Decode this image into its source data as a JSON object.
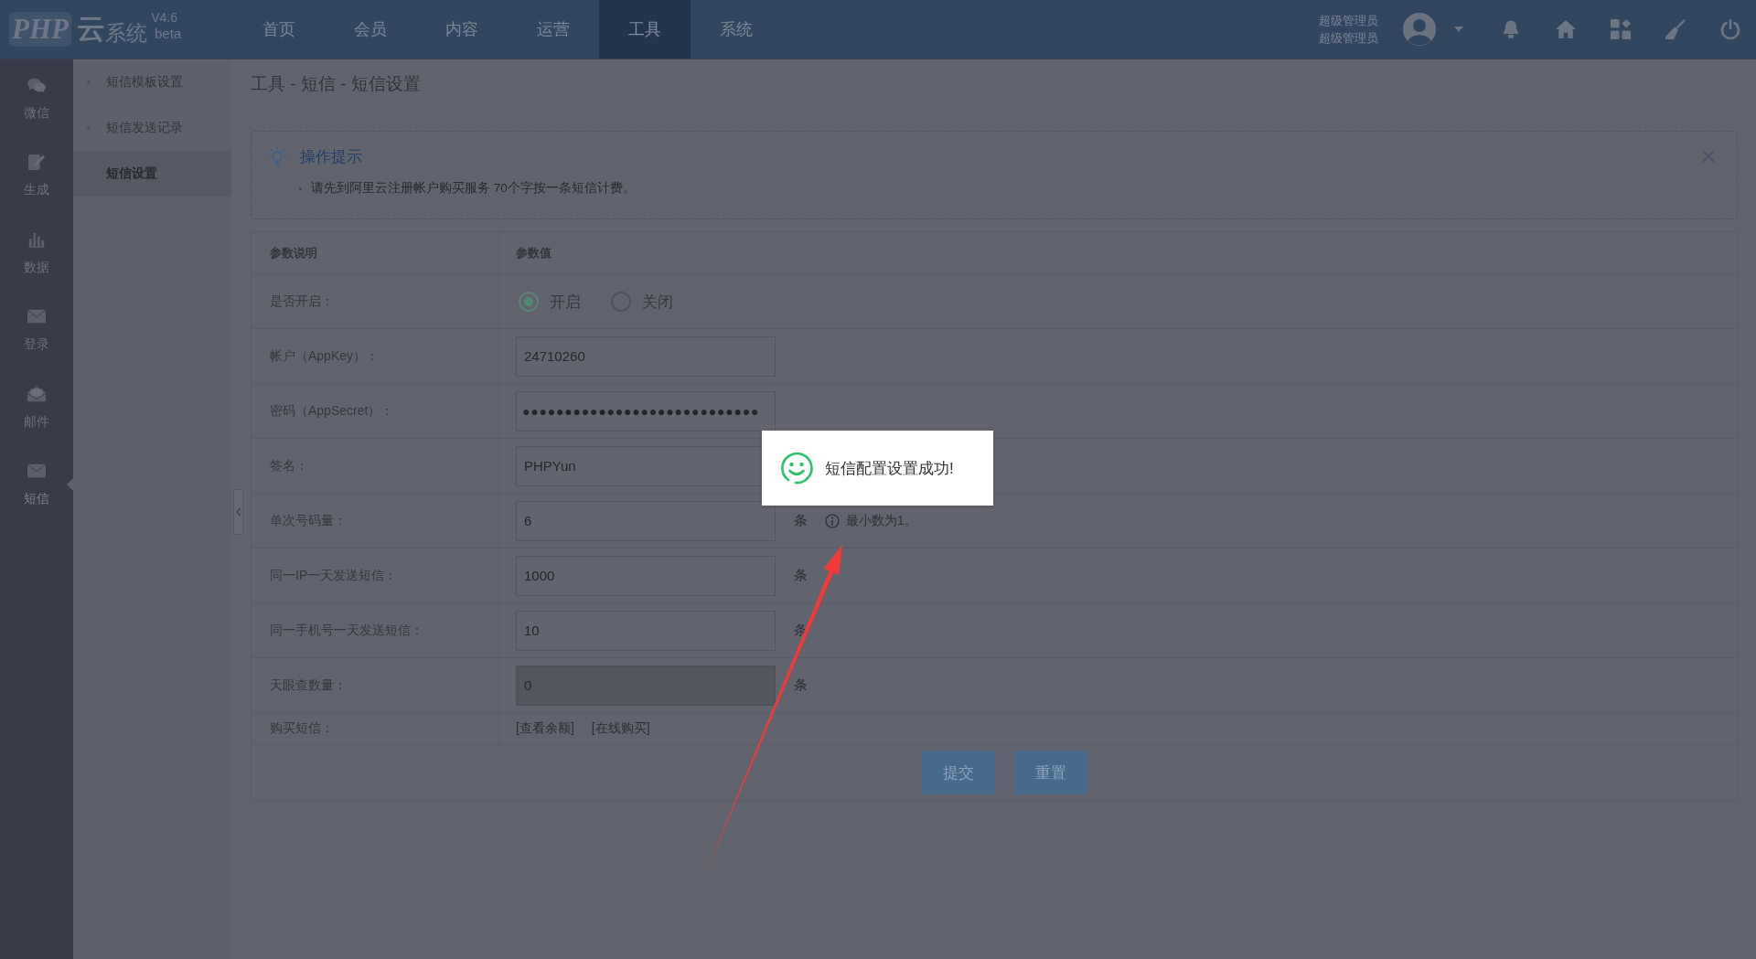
{
  "header": {
    "logo": {
      "brand": "PHP",
      "mark": "云",
      "name": "系统",
      "version": "V4.6",
      "edition": "beta"
    },
    "nav": [
      {
        "label": "首页",
        "selected": false
      },
      {
        "label": "会员",
        "selected": false
      },
      {
        "label": "内容",
        "selected": false
      },
      {
        "label": "运营",
        "selected": false
      },
      {
        "label": "工具",
        "selected": true
      },
      {
        "label": "系统",
        "selected": false
      }
    ],
    "user": {
      "lines": [
        "超级管理员",
        "超级管理员"
      ]
    }
  },
  "sidebar": {
    "items": [
      {
        "label": "微信",
        "selected": false
      },
      {
        "label": "生成",
        "selected": false
      },
      {
        "label": "数据",
        "selected": false
      },
      {
        "label": "登录",
        "selected": false
      },
      {
        "label": "邮件",
        "selected": false
      },
      {
        "label": "短信",
        "selected": true
      }
    ]
  },
  "submenu": {
    "items": [
      {
        "label": "短信模板设置",
        "selected": false
      },
      {
        "label": "短信发送记录",
        "selected": false
      },
      {
        "label": "短信设置",
        "selected": true
      }
    ]
  },
  "breadcrumb": "工具 - 短信 - 短信设置",
  "tips": {
    "title": "操作提示",
    "items": [
      "请先到阿里云注册帐户购买服务 70个字按一条短信计费。"
    ]
  },
  "table": {
    "columns": [
      "参数说明",
      "参数值"
    ],
    "rows": [
      {
        "kind": "radio",
        "label": "是否开启：",
        "disabled": false,
        "options": [
          {
            "label": "开启",
            "selected": true
          },
          {
            "label": "关闭",
            "selected": false
          }
        ]
      },
      {
        "kind": "input",
        "label": "帐户（AppKey）：",
        "value": "24710260",
        "disabled": false
      },
      {
        "kind": "password",
        "label": "密码（AppSecret）：",
        "value": "●●●●●●●●●●●●●●●●●●●●●●●●●●●●",
        "disabled": false
      },
      {
        "kind": "input",
        "label": "签名：",
        "value": "PHPYun",
        "disabled": false
      },
      {
        "kind": "input",
        "label": "单次号码量：",
        "value": "6",
        "disabled": false,
        "unit": "条",
        "hint": "最小数为1。"
      },
      {
        "kind": "input",
        "label": "同一IP一天发送短信：",
        "value": "1000",
        "disabled": false,
        "unit": "条"
      },
      {
        "kind": "input",
        "label": "同一手机号一天发送短信：",
        "value": "10",
        "disabled": false,
        "unit": "条"
      },
      {
        "kind": "input",
        "label": "天眼查数量：",
        "value": "0",
        "disabled": true,
        "unit": "条"
      },
      {
        "kind": "links",
        "label": "购买短信：",
        "disabled": false,
        "links": [
          "[查看余额]",
          "[在线购买]"
        ]
      }
    ]
  },
  "buttons": [
    {
      "label": "提交"
    },
    {
      "label": "重置"
    }
  ],
  "toast": {
    "message": "短信配置设置成功!"
  }
}
